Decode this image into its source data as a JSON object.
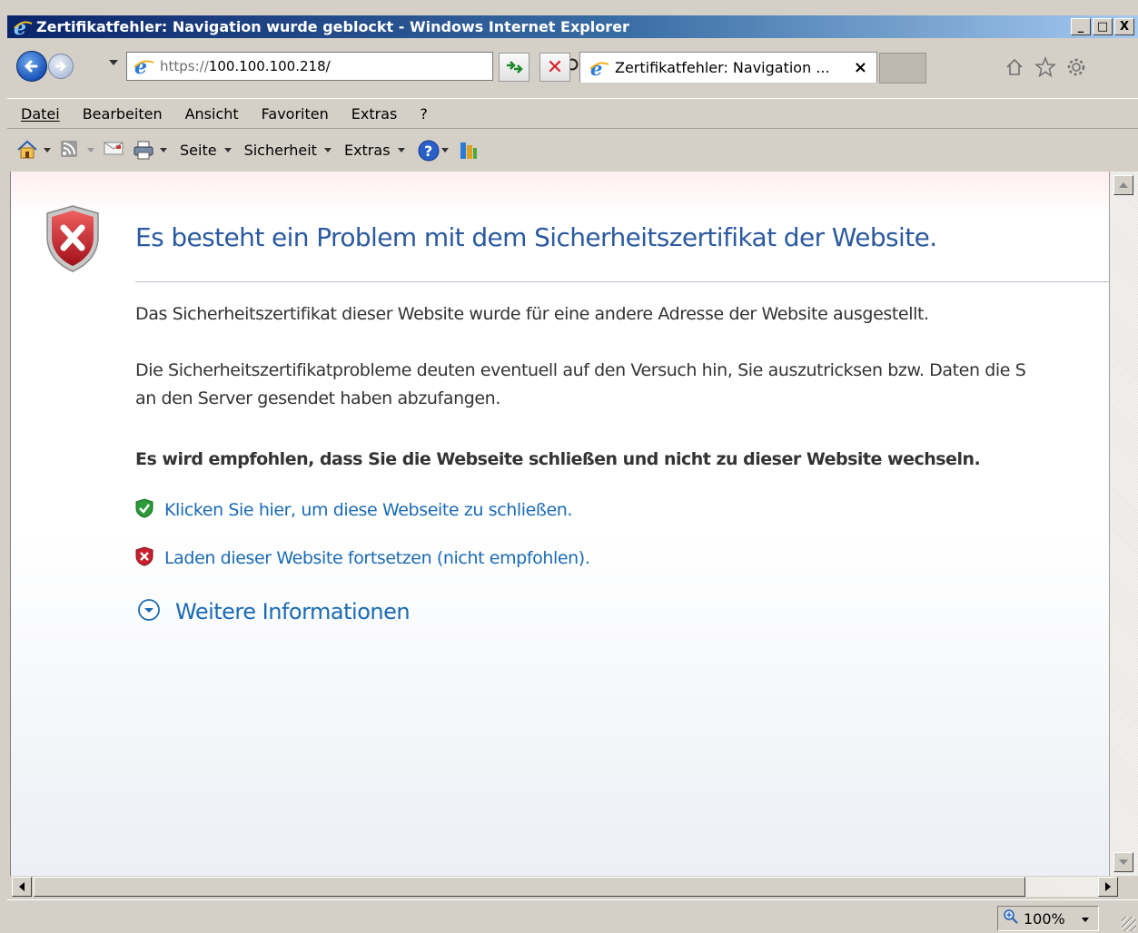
{
  "window": {
    "title": "Zertifikatfehler: Navigation wurde geblockt - Windows Internet Explorer",
    "controls": {
      "minimize": "_",
      "maximize": "□",
      "close": "X"
    }
  },
  "address_bar": {
    "protocol": "https://",
    "host": "100.100.100.218/",
    "icons": [
      "ie-logo-icon",
      "search-icon",
      "dropdown-arrow-icon"
    ]
  },
  "tab": {
    "label": "Zertifikatfehler: Navigation ...",
    "close": "×"
  },
  "toolbar_right_icons": [
    "home-icon",
    "favorites-star-icon",
    "settings-gear-icon"
  ],
  "menu": {
    "items": [
      {
        "label": "Datei",
        "accel": "D"
      },
      {
        "label": "Bearbeiten",
        "accel": "B"
      },
      {
        "label": "Ansicht",
        "accel": "A"
      },
      {
        "label": "Favoriten",
        "accel": "F"
      },
      {
        "label": "Extras",
        "accel": "x"
      },
      {
        "label": "?",
        "accel": "?"
      }
    ]
  },
  "command_bar": {
    "page": "Seite",
    "safety": "Sicherheit",
    "tools": "Extras"
  },
  "content": {
    "headline": "Es besteht ein Problem mit dem Sicherheitszertifikat der Website.",
    "para1": "Das Sicherheitszertifikat dieser Website wurde für eine andere Adresse der Website ausgestellt.",
    "para2_line1": "Die Sicherheitszertifikatprobleme deuten eventuell auf den Versuch hin, Sie auszutricksen bzw. Daten die S",
    "para2_line2": "an den Server gesendet haben abzufangen.",
    "recommendation": "Es wird empfohlen, dass Sie die Webseite schließen und nicht zu dieser Website wechseln.",
    "close_link": "Klicken Sie hier, um diese Webseite zu schließen.",
    "continue_link": "Laden dieser Website fortsetzen (nicht empfohlen).",
    "more_info": "Weitere Informationen"
  },
  "status_bar": {
    "zoom": "100%"
  },
  "colors": {
    "headline": "#2c5aa0",
    "link": "#1a6ab4",
    "error_red": "#c8202c",
    "ok_green": "#2c9a3a"
  }
}
